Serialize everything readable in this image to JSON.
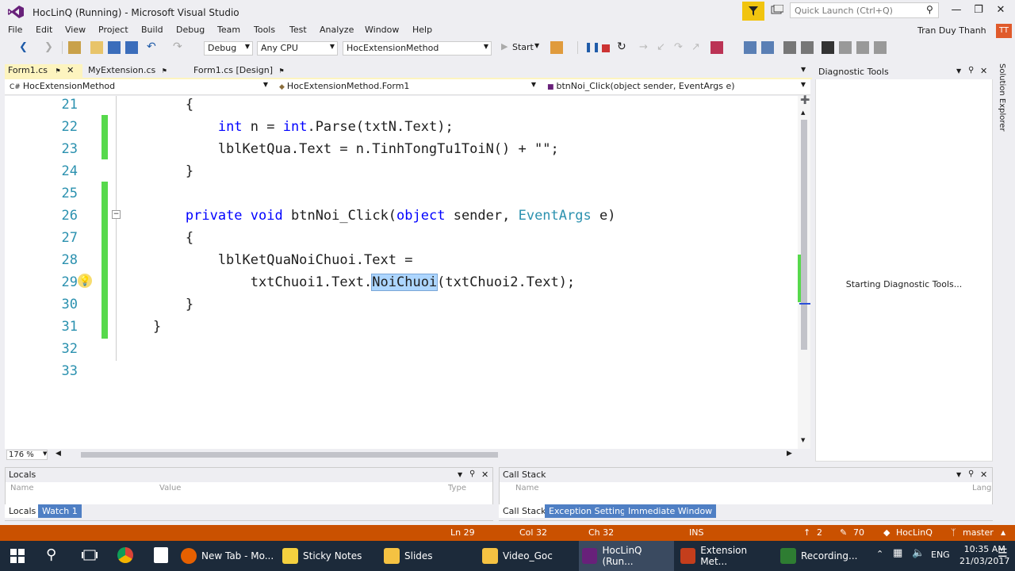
{
  "window": {
    "title": "HocLinQ (Running) - Microsoft Visual Studio"
  },
  "titlebar": {
    "quick_launch_placeholder": "Quick Launch (Ctrl+Q)",
    "minimize": "—",
    "restore": "❐",
    "close": "✕"
  },
  "menu": {
    "items": [
      "File",
      "Edit",
      "View",
      "Project",
      "Build",
      "Debug",
      "Team",
      "Tools",
      "Test",
      "Analyze",
      "Window",
      "Help"
    ],
    "user": "Tran Duy Thanh",
    "user_initials": "TT"
  },
  "toolbar": {
    "config": "Debug",
    "platform": "Any CPU",
    "startup": "HocExtensionMethod",
    "start": "Start"
  },
  "tabs": [
    {
      "label": "Form1.cs",
      "pin": "⚑",
      "close": "✕"
    },
    {
      "label": "MyExtension.cs",
      "pin": "⚑"
    },
    {
      "label": "Form1.cs [Design]",
      "pin": "⚑"
    }
  ],
  "navbar": {
    "project": "HocExtensionMethod",
    "class": "HocExtensionMethod.Form1",
    "member": "btnNoi_Click(object sender, EventArgs e)"
  },
  "code": {
    "lines": [
      {
        "num": "21",
        "tokens": [
          {
            "t": "        {",
            "c": "p"
          }
        ]
      },
      {
        "num": "22",
        "tokens": [
          {
            "t": "            ",
            "c": "p"
          },
          {
            "t": "int",
            "c": "kw"
          },
          {
            "t": " n = ",
            "c": "p"
          },
          {
            "t": "int",
            "c": "kw"
          },
          {
            "t": ".Parse(txtN.Text);",
            "c": "p"
          }
        ]
      },
      {
        "num": "23",
        "tokens": [
          {
            "t": "            lblKetQua.Text = n.TinhTongTu1ToiN() + \"\";",
            "c": "p"
          }
        ]
      },
      {
        "num": "24",
        "tokens": [
          {
            "t": "        }",
            "c": "p"
          }
        ]
      },
      {
        "num": "25",
        "tokens": []
      },
      {
        "num": "26",
        "tokens": [
          {
            "t": "        ",
            "c": "p"
          },
          {
            "t": "private",
            "c": "kw"
          },
          {
            "t": " ",
            "c": "p"
          },
          {
            "t": "void",
            "c": "kw"
          },
          {
            "t": " btnNoi_Click(",
            "c": "p"
          },
          {
            "t": "object",
            "c": "kw"
          },
          {
            "t": " sender, ",
            "c": "p"
          },
          {
            "t": "EventArgs",
            "c": "ty"
          },
          {
            "t": " e)",
            "c": "p"
          }
        ]
      },
      {
        "num": "27",
        "tokens": [
          {
            "t": "        {",
            "c": "p"
          }
        ]
      },
      {
        "num": "28",
        "tokens": [
          {
            "t": "            lblKetQuaNoiChuoi.Text =",
            "c": "p"
          }
        ]
      },
      {
        "num": "29",
        "tokens": [
          {
            "t": "                txtChuoi1.Text.",
            "c": "p"
          },
          {
            "t": "NoiChuoi",
            "c": "sel"
          },
          {
            "t": "(txtChuoi2.Text);",
            "c": "p"
          }
        ]
      },
      {
        "num": "30",
        "tokens": [
          {
            "t": "        }",
            "c": "p"
          }
        ]
      },
      {
        "num": "31",
        "tokens": [
          {
            "t": "    }",
            "c": "p"
          }
        ]
      },
      {
        "num": "32",
        "tokens": []
      },
      {
        "num": "33",
        "tokens": []
      }
    ],
    "zoom": "176 %"
  },
  "diagnostic": {
    "title": "Diagnostic Tools",
    "status": "Starting Diagnostic Tools..."
  },
  "solution_explorer": {
    "label": "Solution Explorer"
  },
  "locals": {
    "title": "Locals",
    "col_name": "Name",
    "col_value": "Value",
    "col_type": "Type",
    "tabs": [
      "Locals",
      "Watch 1"
    ]
  },
  "callstack": {
    "title": "Call Stack",
    "col_name": "Name",
    "col_lang": "Lang",
    "tabs": [
      "Call Stack",
      "Exception Settings",
      "Immediate Window"
    ]
  },
  "status": {
    "ln": "Ln 29",
    "col": "Col 32",
    "ch": "Ch 32",
    "ins": "INS",
    "up": "2",
    "edits": "70",
    "repo": "HocLinQ",
    "branch": "master"
  },
  "taskbar": {
    "apps": [
      {
        "label": "New Tab - Mo...",
        "color": "#e66000"
      },
      {
        "label": "Sticky Notes",
        "color": "#f4d03f"
      },
      {
        "label": "Slides",
        "color": "#f5c242"
      },
      {
        "label": "Video_Goc",
        "color": "#f5c242"
      },
      {
        "label": "HocLinQ (Run...",
        "color": "#68217a"
      },
      {
        "label": "Extension Met...",
        "color": "#c43e1c"
      },
      {
        "label": "Recording...",
        "color": "#2e7d32"
      }
    ],
    "lang": "ENG",
    "time": "10:35 AM",
    "date": "21/03/2017"
  }
}
